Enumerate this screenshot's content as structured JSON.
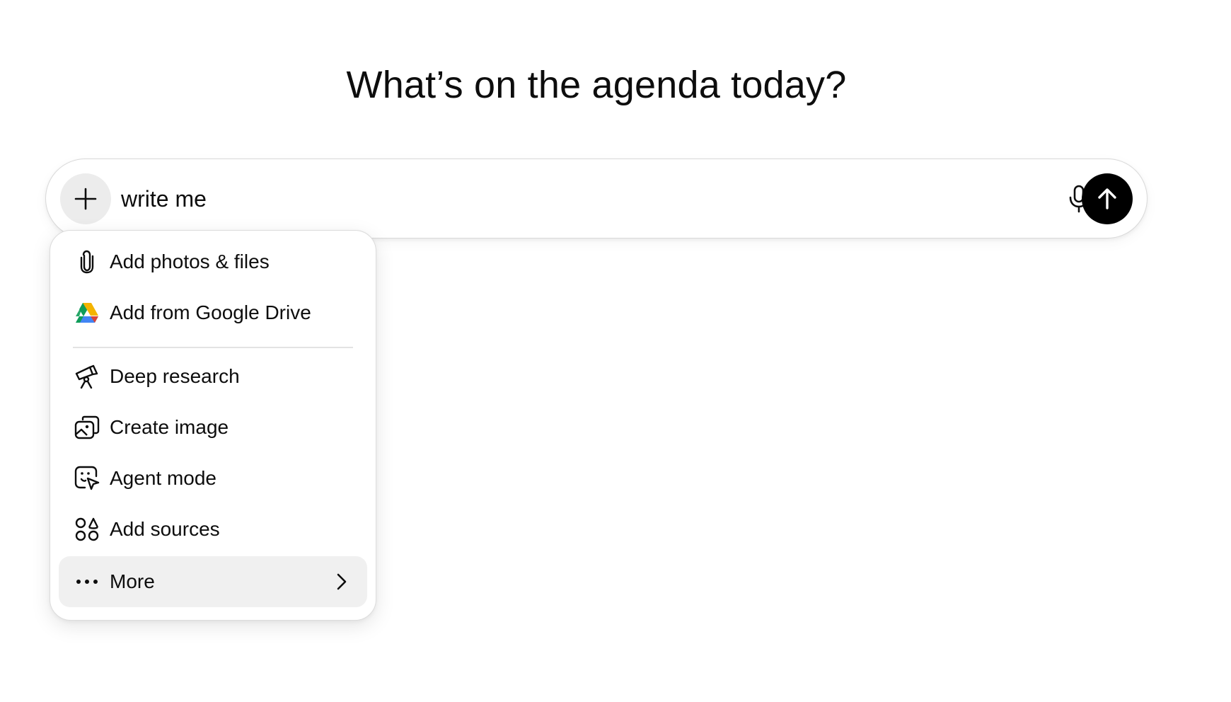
{
  "heading": "What’s on the agenda today?",
  "composer": {
    "input_value": "write me",
    "plus_icon": "plus-icon",
    "mic_icon": "microphone-icon",
    "send_icon": "arrow-up-icon",
    "send_button_color": "#000000"
  },
  "menu": {
    "items": [
      {
        "label": "Add photos & files",
        "icon": "paperclip-icon"
      },
      {
        "label": "Add from Google Drive",
        "icon": "google-drive-icon"
      },
      {
        "label": "Deep research",
        "icon": "telescope-icon"
      },
      {
        "label": "Create image",
        "icon": "image-icon"
      },
      {
        "label": "Agent mode",
        "icon": "agent-cursor-icon"
      },
      {
        "label": "Add sources",
        "icon": "sources-icon"
      },
      {
        "label": "More",
        "icon": "ellipsis-icon",
        "submenu_icon": "chevron-right-icon",
        "highlighted": true
      }
    ]
  }
}
